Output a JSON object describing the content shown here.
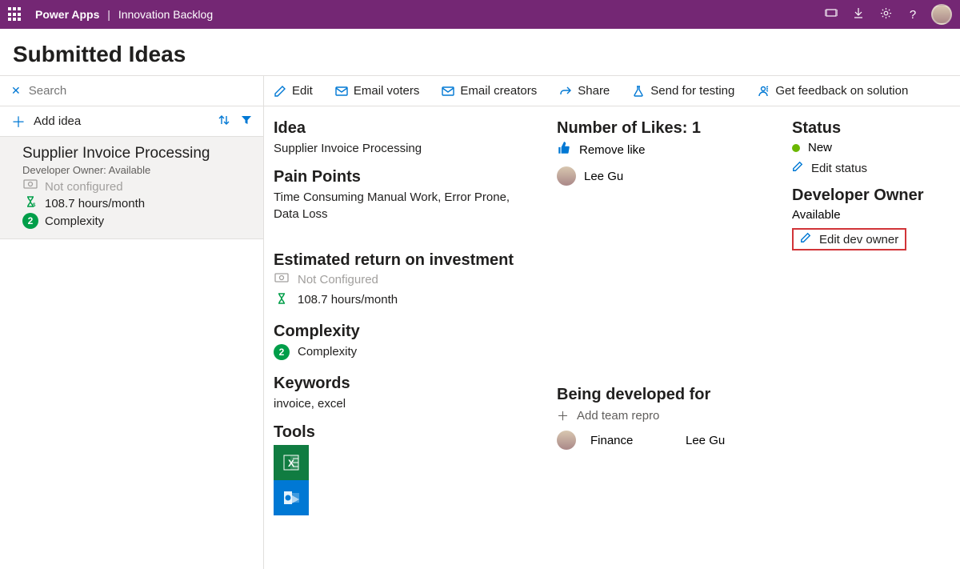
{
  "topbar": {
    "brand": "Power Apps",
    "app": "Innovation Backlog"
  },
  "page_title": "Submitted Ideas",
  "search_placeholder": "Search",
  "add_idea_label": "Add idea",
  "idea_card": {
    "title": "Supplier Invoice Processing",
    "owner": "Developer Owner: Available",
    "roi_config": "Not configured",
    "hours": "108.7 hours/month",
    "complexity_label": "Complexity",
    "complexity_count": "2"
  },
  "actions": {
    "edit": "Edit",
    "email_voters": "Email voters",
    "email_creators": "Email creators",
    "share": "Share",
    "send_testing": "Send for testing",
    "feedback": "Get feedback on solution"
  },
  "detail": {
    "idea_heading": "Idea",
    "idea_text": "Supplier Invoice Processing",
    "pain_heading": "Pain Points",
    "pain_text": "Time Consuming Manual Work, Error Prone, Data Loss",
    "roi_heading": "Estimated return on investment",
    "roi_config": "Not Configured",
    "roi_hours": "108.7 hours/month",
    "complexity_heading": "Complexity",
    "complexity_label": "Complexity",
    "complexity_count": "2",
    "keywords_heading": "Keywords",
    "keywords_text": "invoice, excel",
    "tools_heading": "Tools"
  },
  "likes": {
    "heading": "Number of Likes: 1",
    "remove_label": "Remove like",
    "voter": "Lee Gu"
  },
  "dev_for": {
    "heading": "Being developed for",
    "add_label": "Add team repro",
    "team": "Finance",
    "person": "Lee Gu"
  },
  "status": {
    "heading": "Status",
    "value": "New",
    "edit_status": "Edit status",
    "dev_owner_heading": "Developer Owner",
    "dev_owner_value": "Available",
    "edit_dev_owner": "Edit dev owner"
  }
}
